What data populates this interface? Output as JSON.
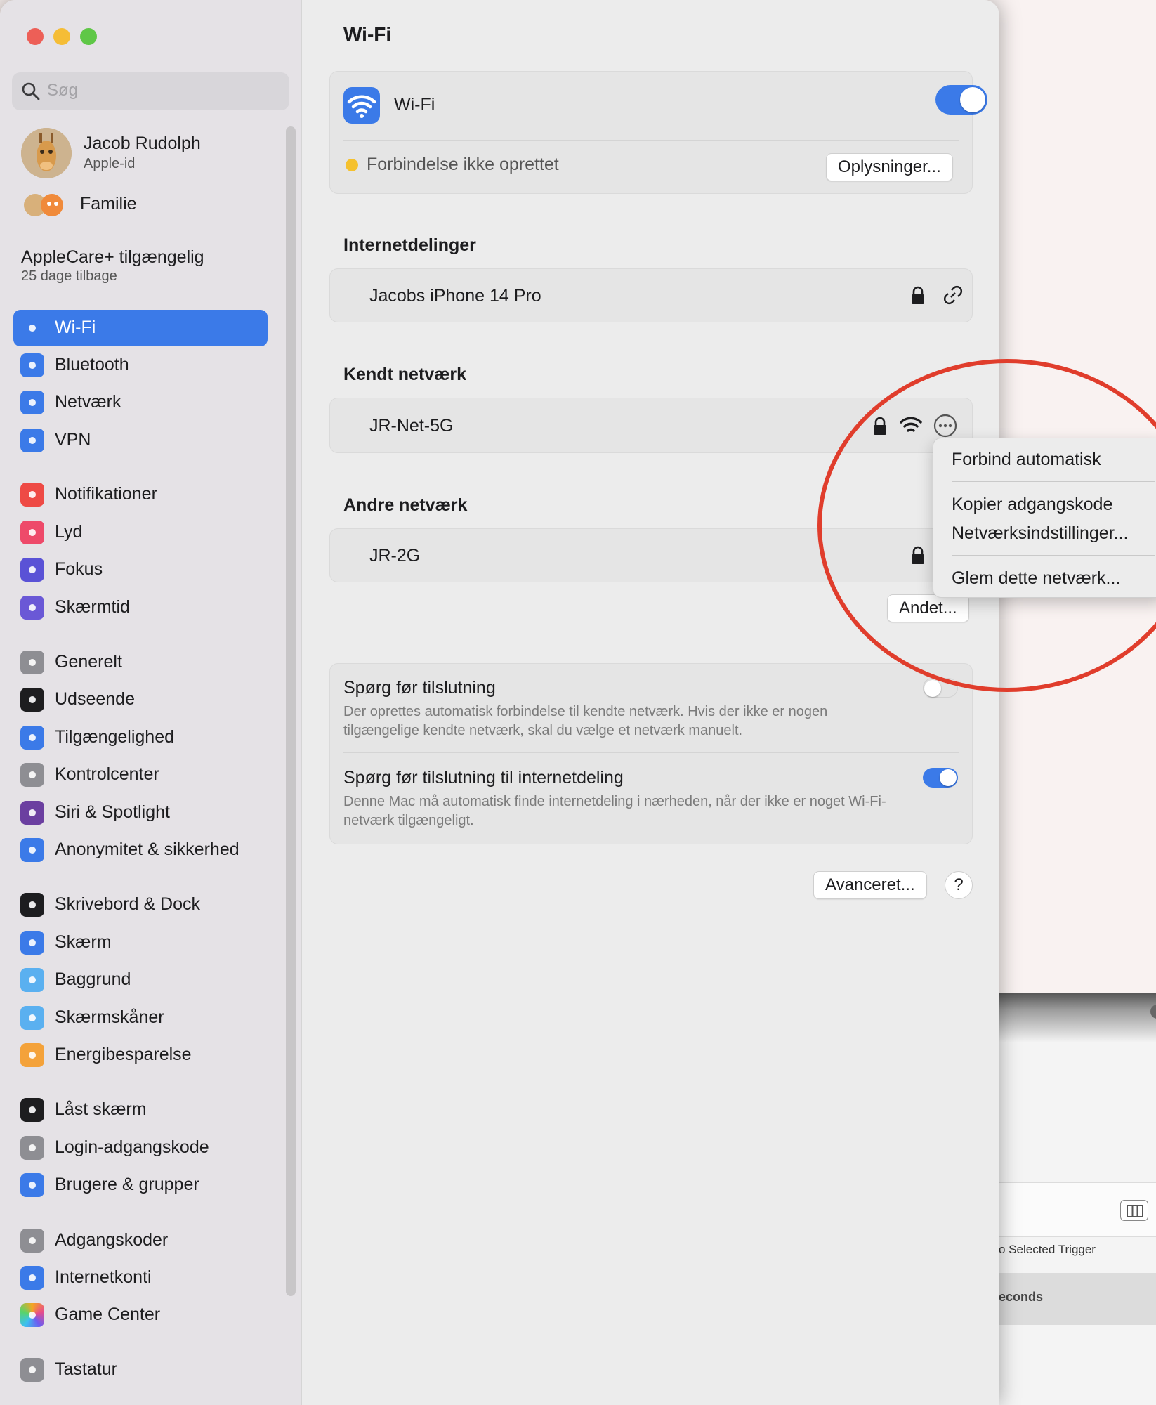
{
  "window": {
    "title": "Wi-Fi"
  },
  "sidebar": {
    "search_placeholder": "Søg",
    "user": {
      "name": "Jacob Rudolph",
      "subtitle": "Apple-id"
    },
    "family": "Familie",
    "applecare": {
      "title": "AppleCare+ tilgængelig",
      "subtitle": "25 dage tilbage"
    },
    "items": [
      {
        "label": "Wi-Fi",
        "icon": "wifi-icon",
        "color": "#3b7ae8",
        "selected": true
      },
      {
        "label": "Bluetooth",
        "icon": "bluetooth-icon",
        "color": "#3b7ae8"
      },
      {
        "label": "Netværk",
        "icon": "globe-icon",
        "color": "#3b7ae8"
      },
      {
        "label": "VPN",
        "icon": "globe-icon",
        "color": "#3b7ae8"
      },
      {
        "label": "Notifikationer",
        "icon": "bell-icon",
        "color": "#ee4a45"
      },
      {
        "label": "Lyd",
        "icon": "speaker-icon",
        "color": "#ee4a6a"
      },
      {
        "label": "Fokus",
        "icon": "moon-icon",
        "color": "#5a52d6"
      },
      {
        "label": "Skærmtid",
        "icon": "hourglass-icon",
        "color": "#6a58d6"
      },
      {
        "label": "Generelt",
        "icon": "gear-icon",
        "color": "#8e8e93"
      },
      {
        "label": "Udseende",
        "icon": "appearance-icon",
        "color": "#1d1d1f"
      },
      {
        "label": "Tilgængelighed",
        "icon": "accessibility-icon",
        "color": "#3b7ae8"
      },
      {
        "label": "Kontrolcenter",
        "icon": "toggles-icon",
        "color": "#8e8e93"
      },
      {
        "label": "Siri & Spotlight",
        "icon": "siri-icon",
        "color": "#6b3fa0"
      },
      {
        "label": "Anonymitet & sikkerhed",
        "icon": "hand-icon",
        "color": "#3b7ae8"
      },
      {
        "label": "Skrivebord & Dock",
        "icon": "dock-icon",
        "color": "#1d1d1f"
      },
      {
        "label": "Skærm",
        "icon": "sun-icon",
        "color": "#3b7ae8"
      },
      {
        "label": "Baggrund",
        "icon": "flower-icon",
        "color": "#5ab0f0"
      },
      {
        "label": "Skærmskåner",
        "icon": "screensaver-icon",
        "color": "#5ab0f0"
      },
      {
        "label": "Energibesparelse",
        "icon": "bulb-icon",
        "color": "#f4a23a"
      },
      {
        "label": "Låst skærm",
        "icon": "lock-screen-icon",
        "color": "#1d1d1f"
      },
      {
        "label": "Login-adgangskode",
        "icon": "lock-icon",
        "color": "#8e8e93"
      },
      {
        "label": "Brugere & grupper",
        "icon": "users-icon",
        "color": "#3b7ae8"
      },
      {
        "label": "Adgangskoder",
        "icon": "key-icon",
        "color": "#8e8e93"
      },
      {
        "label": "Internetkonti",
        "icon": "at-icon",
        "color": "#3b7ae8"
      },
      {
        "label": "Game Center",
        "icon": "game-center-icon",
        "color": "#ffffff"
      },
      {
        "label": "Tastatur",
        "icon": "keyboard-icon",
        "color": "#8e8e93"
      }
    ]
  },
  "main": {
    "title": "Wi-Fi",
    "wifi_label": "Wi-Fi",
    "wifi_enabled": true,
    "status_text": "Forbindelse ikke oprettet",
    "status_color": "#f5c12e",
    "details_button": "Oplysninger...",
    "hotspots": {
      "header": "Internetdelinger",
      "items": [
        {
          "name": "Jacobs iPhone 14 Pro"
        }
      ]
    },
    "known": {
      "header": "Kendt netværk",
      "items": [
        {
          "name": "JR-Net-5G"
        }
      ]
    },
    "other": {
      "header": "Andre netværk",
      "items": [
        {
          "name": "JR-2G"
        }
      ],
      "other_button": "Andet..."
    },
    "ask_join": {
      "title": "Spørg før tilslutning",
      "desc": "Der oprettes automatisk forbindelse til kendte netværk. Hvis der ikke er nogen tilgængelige kendte netværk, skal du vælge et netværk manuelt.",
      "enabled": false
    },
    "ask_hotspot": {
      "title": "Spørg før tilslutning til internetdeling",
      "desc": "Denne Mac må automatisk finde internetdeling i nærheden, når der ikke er noget Wi-Fi-netværk tilgængeligt.",
      "enabled": true
    },
    "advanced_button": "Avanceret...",
    "help_button": "?"
  },
  "context_menu": {
    "items": [
      "Forbind automatisk",
      "Kopier adgangskode",
      "Netværksindstillinger...",
      "Glem dette netværk..."
    ]
  },
  "background_window": {
    "trigger_text": "o Selected Trigger",
    "row_text": "econds"
  },
  "colors": {
    "accent": "#3b7ae8",
    "annotation": "#e03d2c"
  }
}
